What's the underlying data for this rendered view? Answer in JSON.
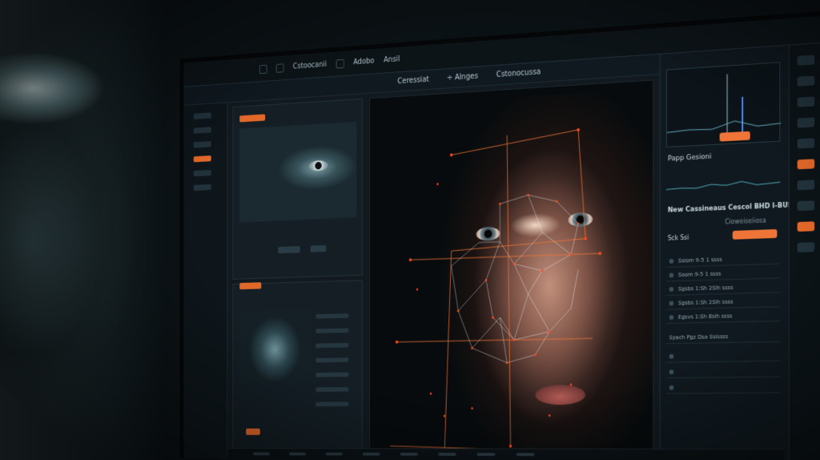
{
  "app": {
    "topbar_items": [
      "Cstoocanii",
      "Adobo",
      "Ansil"
    ],
    "toolbar_items": [
      "Ceressiat",
      "÷ Alnges",
      "Cstonocussa"
    ]
  },
  "right_panel": {
    "section1_title": "Papp Gesioni",
    "section2_title": "New Cassineaus Cescol BHD I-BUS",
    "tab_label": "Cioweiseiiosa",
    "apply_label": "Sck Ssi",
    "rows": [
      {
        "label": "Ssiom 9-5 1 ssss"
      },
      {
        "label": "Soom 9-5 1 ssss"
      },
      {
        "label": "Sgsbs 1:Sh 2Slh ssss"
      },
      {
        "label": "Sgsbs 1:Sh 2Slh ssss"
      },
      {
        "label": "Egsvs 1:Sh 8slh ssss"
      }
    ],
    "footer_row": "Syach Pgz Dsa Ssissss"
  },
  "colors": {
    "accent": "#ef7437",
    "mesh_line": "#e9f0f2",
    "landmark": "#ff4a1c",
    "panel_bg": "#10191f"
  },
  "icons": [
    "face-mesh-icon",
    "settings-icon",
    "close-icon",
    "search-icon"
  ]
}
